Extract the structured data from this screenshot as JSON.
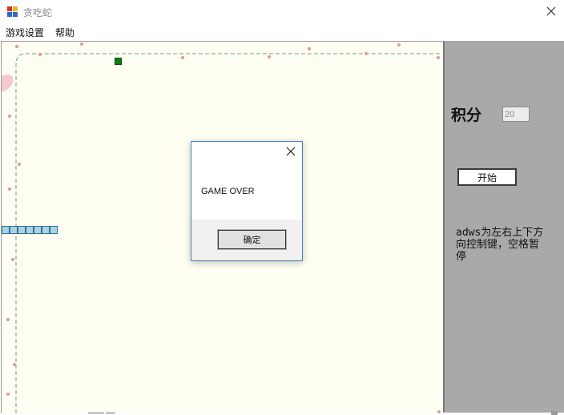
{
  "window": {
    "title": "贪吃蛇",
    "icon": "app-window-icon"
  },
  "menu": {
    "items": [
      "游戏设置",
      "帮助"
    ]
  },
  "board": {
    "food_color": "#0a7a14",
    "snake_color": "#a7d3e8",
    "snake_segments": 7
  },
  "panel": {
    "score_label": "积分",
    "score_value": "20",
    "start_label": "开始",
    "help_text": "adws为左右上下方向控制键，空格暂停"
  },
  "dialog": {
    "message": "GAME OVER",
    "ok_label": "确定"
  }
}
